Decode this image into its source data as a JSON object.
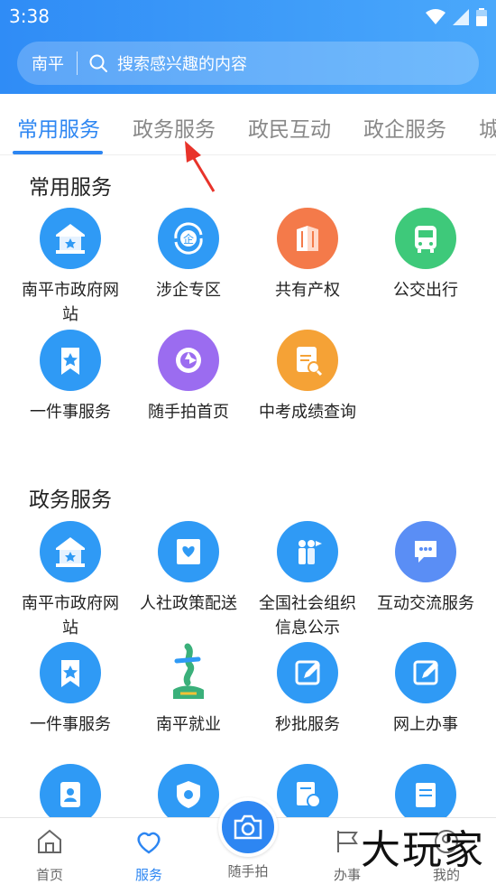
{
  "status_bar": {
    "time": "3:38"
  },
  "search": {
    "city": "南平",
    "placeholder": "搜索感兴趣的内容"
  },
  "tabs": [
    "常用服务",
    "政务服务",
    "政民互动",
    "政企服务",
    "城"
  ],
  "sections": [
    {
      "title": "常用服务",
      "items": [
        {
          "label": "南平市政府网站",
          "icon": "government-building-icon",
          "color": "#2f9af5"
        },
        {
          "label": "涉企专区",
          "icon": "enterprise-icon",
          "color": "#2f9af5"
        },
        {
          "label": "共有产权",
          "icon": "building-icon",
          "color": "#f47a4a"
        },
        {
          "label": "公交出行",
          "icon": "bus-icon",
          "color": "#3ec97a"
        },
        {
          "label": "一件事服务",
          "icon": "star-bookmark-icon",
          "color": "#2f9af5"
        },
        {
          "label": "随手拍首页",
          "icon": "camera-aperture-icon",
          "color": "#9b6cf0"
        },
        {
          "label": "中考成绩查询",
          "icon": "exam-score-icon",
          "color": "#f5a236"
        }
      ]
    },
    {
      "title": "政务服务",
      "items": [
        {
          "label": "南平市政府网站",
          "icon": "government-building-icon",
          "color": "#2f9af5"
        },
        {
          "label": "人社政策配送",
          "icon": "social-security-icon",
          "color": "#2f9af5"
        },
        {
          "label": "全国社会组织信息公示",
          "icon": "people-flag-icon",
          "color": "#2f9af5"
        },
        {
          "label": "互动交流服务",
          "icon": "chat-bubble-icon",
          "color": "#5a8ef5"
        },
        {
          "label": "一件事服务",
          "icon": "star-bookmark-icon",
          "color": "#2f9af5"
        },
        {
          "label": "南平就业",
          "icon": "nanping-employment-logo",
          "color": "#3ab07a"
        },
        {
          "label": "秒批服务",
          "icon": "edit-form-icon",
          "color": "#2f9af5"
        },
        {
          "label": "网上办事",
          "icon": "edit-form-icon",
          "color": "#2f9af5"
        },
        {
          "label": "",
          "icon": "badge-id-icon",
          "color": "#2f9af5"
        },
        {
          "label": "",
          "icon": "shield-star-icon",
          "color": "#2f9af5"
        },
        {
          "label": "",
          "icon": "document-clock-icon",
          "color": "#2f9af5"
        },
        {
          "label": "",
          "icon": "notebook-pen-icon",
          "color": "#2f9af5"
        }
      ]
    }
  ],
  "bottom_nav": [
    {
      "label": "首页",
      "icon": "home-icon"
    },
    {
      "label": "服务",
      "icon": "heart-icon"
    },
    {
      "label": "随手拍",
      "icon": "camera-icon"
    },
    {
      "label": "办事",
      "icon": "flag-icon"
    },
    {
      "label": "我的",
      "icon": "user-icon"
    }
  ],
  "watermark": "大玩家",
  "colors": {
    "primary": "#2d86f2",
    "header_start": "#2f8cf6",
    "header_end": "#4aa8fb",
    "annotation_arrow": "#e8332a"
  }
}
